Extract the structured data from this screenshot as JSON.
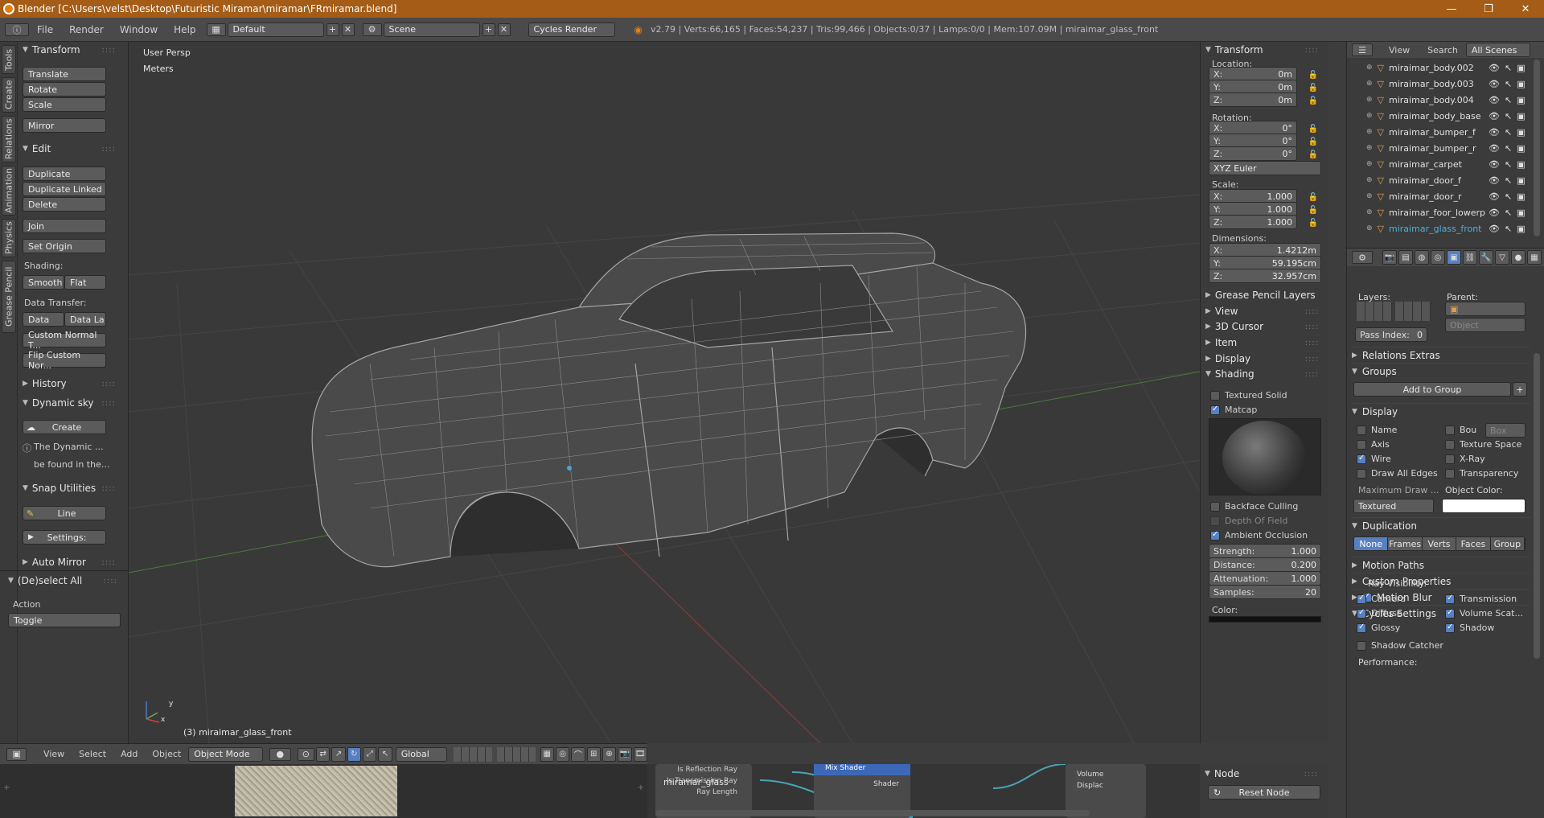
{
  "window": {
    "title": "Blender [C:\\Users\\velst\\Desktop\\Futuristic Miramar\\miramar\\FRmiramar.blend]",
    "controls": [
      "—",
      "❐",
      "✕"
    ]
  },
  "menubar": {
    "items": [
      "File",
      "Render",
      "Window",
      "Help"
    ],
    "layout": "Default",
    "scene": "Scene",
    "engine": "Cycles Render",
    "stats": "v2.79 | Verts:66,165 | Faces:54,237 | Tris:99,466 | Objects:0/37 | Lamps:0/0 | Mem:107.09M | miraimar_glass_front"
  },
  "tool_tabs": [
    "Tools",
    "Create",
    "Relations",
    "Animation",
    "Physics",
    "Grease Pencil"
  ],
  "tools": {
    "transform_header": "Transform",
    "translate": "Translate",
    "rotate": "Rotate",
    "scale": "Scale",
    "mirror": "Mirror",
    "edit_header": "Edit",
    "duplicate": "Duplicate",
    "duplicate_linked": "Duplicate Linked",
    "delete": "Delete",
    "join": "Join",
    "set_origin": "Set Origin",
    "shading_label": "Shading:",
    "smooth": "Smooth",
    "flat": "Flat",
    "data_transfer_label": "Data Transfer:",
    "data": "Data",
    "data_la": "Data La",
    "custom_normal": "Custom Normal T...",
    "flip_custom": "Flip Custom Nor...",
    "history_header": "History",
    "dynamic_sky_header": "Dynamic sky",
    "create": "Create",
    "info_line1": "The Dynamic ...",
    "info_line2": "be found in the...",
    "snap_header": "Snap Utilities",
    "line": "Line",
    "settings": "Settings:",
    "auto_mirror": "Auto Mirror",
    "deselect_header": "(De)select All",
    "action_label": "Action",
    "action_value": "Toggle"
  },
  "viewport": {
    "persp": "User Persp",
    "units": "Meters",
    "object": "(3) miraimar_glass_front",
    "axis_y": "y",
    "axis_x": "x"
  },
  "npanel": {
    "transform_header": "Transform",
    "location_label": "Location:",
    "loc": [
      {
        "k": "X:",
        "v": "0m"
      },
      {
        "k": "Y:",
        "v": "0m"
      },
      {
        "k": "Z:",
        "v": "0m"
      }
    ],
    "rotation_label": "Rotation:",
    "rot": [
      {
        "k": "X:",
        "v": "0°"
      },
      {
        "k": "Y:",
        "v": "0°"
      },
      {
        "k": "Z:",
        "v": "0°"
      }
    ],
    "rot_mode": "XYZ Euler",
    "scale_label": "Scale:",
    "scale": [
      {
        "k": "X:",
        "v": "1.000"
      },
      {
        "k": "Y:",
        "v": "1.000"
      },
      {
        "k": "Z:",
        "v": "1.000"
      }
    ],
    "dimensions_label": "Dimensions:",
    "dim": [
      {
        "k": "X:",
        "v": "1.4212m"
      },
      {
        "k": "Y:",
        "v": "59.195cm"
      },
      {
        "k": "Z:",
        "v": "32.957cm"
      }
    ],
    "grease_pencil": "Grease Pencil Layers",
    "view": "View",
    "cursor": "3D Cursor",
    "item": "Item",
    "display": "Display",
    "shading": "Shading",
    "textured_solid": "Textured Solid",
    "matcap": "Matcap",
    "backface": "Backface Culling",
    "dof": "Depth Of Field",
    "ao": "Ambient Occlusion",
    "ao_fields": [
      {
        "k": "Strength:",
        "v": "1.000"
      },
      {
        "k": "Distance:",
        "v": "0.200"
      },
      {
        "k": "Attenuation:",
        "v": "1.000"
      },
      {
        "k": "Samples:",
        "v": "20"
      }
    ],
    "color_label": "Color:",
    "node_header": "Node",
    "reset_node": "Reset Node"
  },
  "outliner": {
    "tabs": [
      "View",
      "Search",
      "All Scenes"
    ],
    "rows": [
      "miraimar_body.002",
      "miraimar_body.003",
      "miraimar_body.004",
      "miraimar_body_base",
      "miraimar_bumper_f",
      "miraimar_bumper_r",
      "miraimar_carpet",
      "miraimar_door_f",
      "miraimar_door_r",
      "miraimar_foor_lowerp",
      "miraimar_glass_front"
    ]
  },
  "props": {
    "layers_label": "Layers:",
    "parent_label": "Parent:",
    "parent_type": "Object",
    "pass_index": "Pass Index:",
    "pass_value": "0",
    "relations_extras": "Relations Extras",
    "groups": "Groups",
    "add_to_group": "Add to Group",
    "display": "Display",
    "name": "Name",
    "bou": "Bou",
    "box": "Box",
    "axis": "Axis",
    "texture_space": "Texture Space",
    "wire": "Wire",
    "xray": "X-Ray",
    "draw_all_edges": "Draw All Edges",
    "transparency": "Transparency",
    "max_draw": "Maximum Draw ...",
    "object_color": "Object Color:",
    "textured": "Textured",
    "duplication": "Duplication",
    "dup_modes": [
      "None",
      "Frames",
      "Verts",
      "Faces",
      "Group"
    ],
    "motion_paths": "Motion Paths",
    "custom_properties": "Custom Properties",
    "motion_blur": "Motion Blur",
    "cycles_settings": "Cycles Settings",
    "ray_visibility": "Ray Visibility:",
    "camera": "Camera",
    "transmission": "Transmission",
    "diffuse": "Diffuse",
    "volume_scat": "Volume Scat...",
    "glossy": "Glossy",
    "shadow": "Shadow",
    "shadow_catcher": "Shadow Catcher",
    "performance": "Performance:"
  },
  "bottom": {
    "items": [
      "View",
      "Select",
      "Add",
      "Object"
    ],
    "mode": "Object Mode",
    "orientation": "Global",
    "node_label": "miramar_glass",
    "reflection_ray": "Is Reflection Ray",
    "transmission_ray": "Is Transmission Ray",
    "ray_length": "Ray Length",
    "mix_shader": "Mix Shader",
    "shader": "Shader",
    "volume": "Volume",
    "displace": "Displac"
  }
}
